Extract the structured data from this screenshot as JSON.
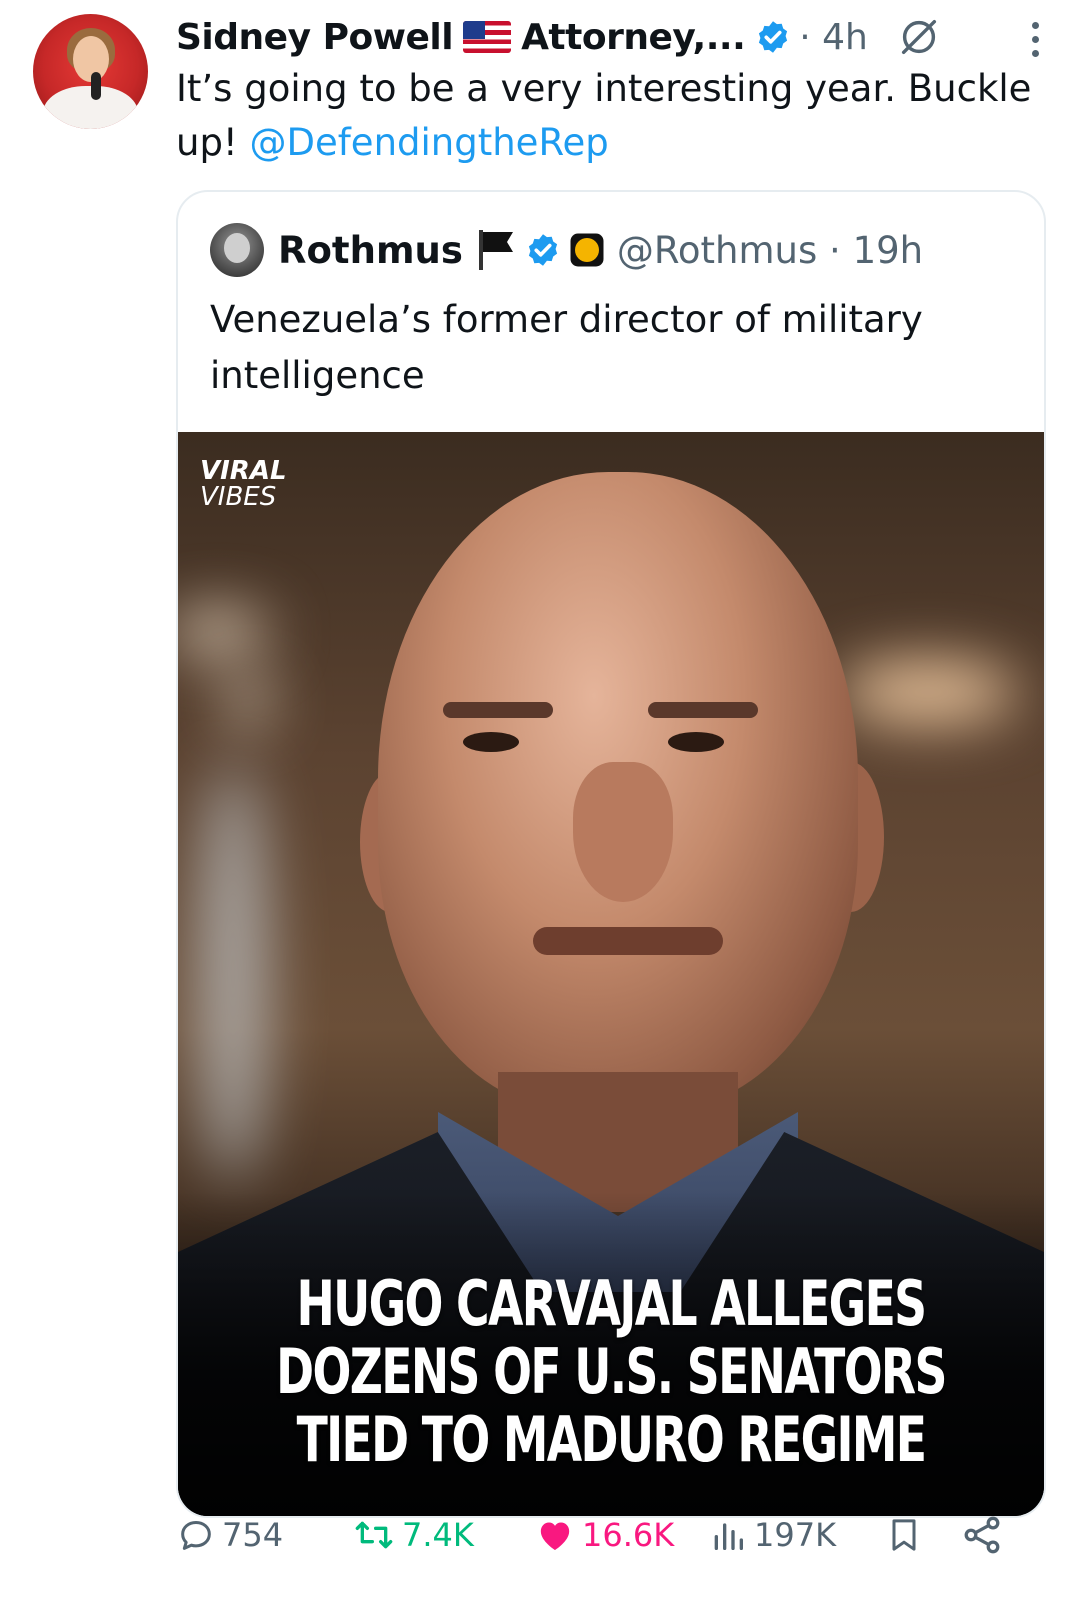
{
  "post": {
    "author_name": "Sidney Powell",
    "author_affiliation": "Attorney,...",
    "time": "4h",
    "text_before_mention": "It’s going to be a very interesting year. Buckle up! ",
    "mention": "@DefendingtheRep"
  },
  "quoted": {
    "author_name": "Rothmus",
    "handle": "@Rothmus",
    "time": "19h",
    "text": "Venezuela’s former director of military intelligence",
    "media": {
      "watermark_line1": "VIRAL",
      "watermark_line2": "VIBES",
      "headline": "HUGO CARVAJAL ALLEGES DOZENS OF U.S. SENATORS TIED TO MADURO REGIME"
    }
  },
  "actions": {
    "replies": "754",
    "reposts": "7.4K",
    "likes": "16.6K",
    "views": "197K"
  },
  "colors": {
    "link": "#1d9bf0",
    "muted": "#536471",
    "repost_active": "#00ba7c",
    "like_active": "#f91880",
    "verified": "#1d9bf0"
  },
  "icons": [
    "verified-badge-icon",
    "us-flag-icon",
    "grok-icon",
    "more-options-icon",
    "pirate-flag-icon",
    "coin-icon",
    "reply-icon",
    "repost-icon",
    "like-icon",
    "views-icon",
    "bookmark-icon",
    "share-icon"
  ]
}
